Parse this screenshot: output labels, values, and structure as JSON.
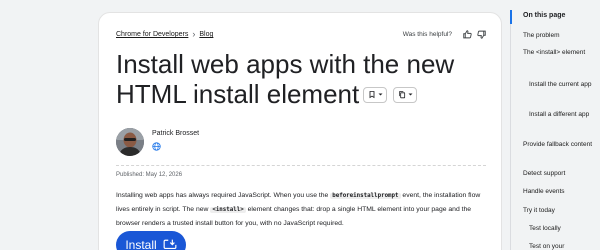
{
  "breadcrumb": {
    "items": [
      "Chrome for Developers",
      "Blog"
    ]
  },
  "feedback": {
    "label": "Was this helpful?"
  },
  "article": {
    "title": "Install web apps with the new HTML install element",
    "author": "Patrick Brosset",
    "published": "Published: May 12, 2026",
    "intro": {
      "p1": "Installing web apps has always required JavaScript. When you use the ",
      "code1": "beforeinstallprompt",
      "p2": " event, the installation flow lives entirely in script. The new ",
      "code2": "<install>",
      "p3": " element changes that: drop a single HTML element into your page and the browser renders a trusted install button for you, with no JavaScript required."
    },
    "install_button": "Install"
  },
  "toc": {
    "heading": "On this page",
    "items": [
      "The problem",
      "The <install> element",
      "Install the current app",
      "Install a different app",
      "Provide fallback content",
      "Detect support",
      "Handle events",
      "Try it today",
      "Test locally",
      "Test on your"
    ]
  },
  "icons": {
    "bookmark": "bookmark-icon",
    "copy": "copy-icon",
    "thumb_up": "thumb-up-icon",
    "thumb_down": "thumb-down-icon",
    "globe": "globe-icon",
    "install": "install-icon"
  },
  "colors": {
    "accent": "#1a73e8",
    "install_button": "#1a57d6"
  }
}
